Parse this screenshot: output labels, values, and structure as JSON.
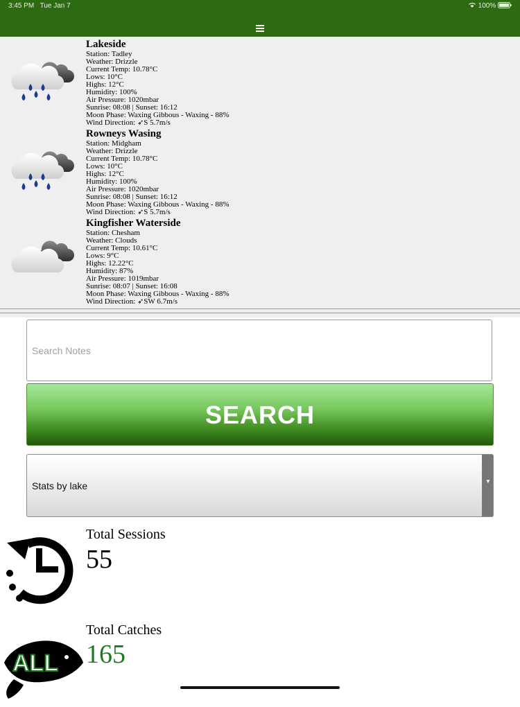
{
  "status_bar": {
    "time": "3:45 PM",
    "date": "Tue Jan 7",
    "battery": "100%"
  },
  "nav": {
    "menu_icon": "hamburger-menu-icon"
  },
  "locations": [
    {
      "name": "Lakeside",
      "icon": "rain-cloud-icon",
      "lines": [
        "Station: Tadley",
        "Weather: Drizzle",
        "Current Temp: 10.78°C",
        "Lows: 10°C",
        "Highs: 12°C",
        "Humidity: 100%",
        "Air Pressure: 1020mbar",
        "Sunrise: 08:08 | Sunset: 16:12",
        "Moon Phase: Waxing Gibbous - Waxing - 88%",
        "Wind Direction: ➶S 5.7m/s"
      ]
    },
    {
      "name": "Rowneys Wasing",
      "icon": "rain-cloud-icon",
      "lines": [
        "Station: Midgham",
        "Weather: Drizzle",
        "Current Temp: 10.78°C",
        "Lows: 10°C",
        "Highs: 12°C",
        "Humidity: 100%",
        "Air Pressure: 1020mbar",
        "Sunrise: 08:08 | Sunset: 16:12",
        "Moon Phase: Waxing Gibbous - Waxing - 88%",
        "Wind Direction: ➶S 5.7m/s"
      ]
    },
    {
      "name": "Kingfisher Waterside",
      "icon": "cloud-icon",
      "lines": [
        "Station: Chesham",
        "Weather: Clouds",
        "Current Temp: 10.61°C",
        "Lows: 9°C",
        "Highs: 12.22°C",
        "Humidity: 87%",
        "Air Pressure: 1019mbar",
        "Sunrise: 08:07 | Sunset: 16:08",
        "Moon Phase: Waxing Gibbous - Waxing - 88%",
        "Wind Direction: ➶SW 6.7m/s"
      ]
    }
  ],
  "search": {
    "placeholder": "Search Notes",
    "button_label": "SEARCH"
  },
  "stats_select": {
    "selected": "Stats by lake"
  },
  "stats": {
    "sessions": {
      "label": "Total Sessions",
      "value": "55",
      "icon": "history-clock-icon"
    },
    "catches": {
      "label": "Total Catches",
      "value": "165",
      "badge": "ALL",
      "icon": "fish-icon",
      "value_color": "#1e7a22"
    }
  }
}
